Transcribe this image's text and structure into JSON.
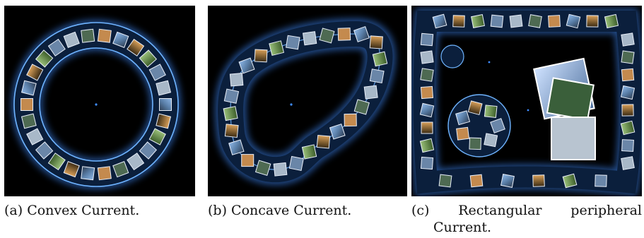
{
  "figures": [
    {
      "id": "a",
      "caption": "(a) Convex Current."
    },
    {
      "id": "b",
      "caption": "(b) Concave Current."
    },
    {
      "id": "c",
      "caption_label": "(c)",
      "caption_word1": "Rectangular",
      "caption_word2": "peripheral",
      "caption_line2": "Current."
    }
  ],
  "colors": {
    "background": "#000000",
    "current_glow": "#3f8cff",
    "current_band": "#0b1f3c",
    "current_edge": "#6fb4ff"
  }
}
